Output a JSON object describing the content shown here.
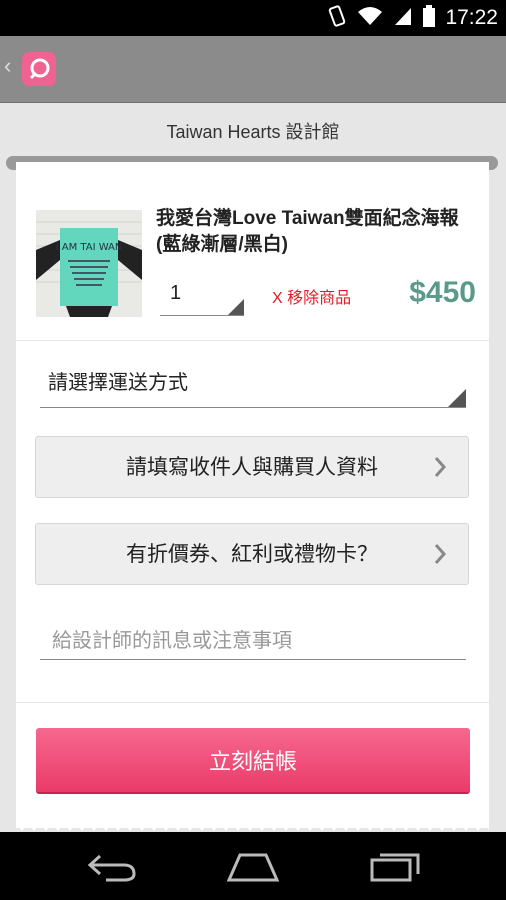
{
  "status_bar": {
    "time": "17:22"
  },
  "app_bar": {
    "back_glyph": "‹"
  },
  "shop": {
    "title": "Taiwan Hearts 設計館"
  },
  "product": {
    "image_text": "I AM TAI WAN",
    "name": "我愛台灣Love Taiwan雙面紀念海報 (藍綠漸層/黑白)",
    "quantity": "1",
    "remove_label": "X 移除商品",
    "price": "$450"
  },
  "shipping": {
    "placeholder": "請選擇運送方式"
  },
  "buttons": {
    "recipient_info": "請填寫收件人與購買人資料",
    "coupon": "有折價券、紅利或禮物卡？"
  },
  "message": {
    "placeholder": "給設計師的訊息或注意事項"
  },
  "checkout": {
    "label": "立刻結帳"
  },
  "colors": {
    "accent": "#ea3b69",
    "price": "#5b9a8b",
    "remove": "#e31b23"
  },
  "icons": [
    "vibrate-icon",
    "wifi-icon",
    "signal-icon",
    "battery-icon",
    "back-chevron-icon",
    "app-logo-icon",
    "chevron-right-icon",
    "nav-back-icon",
    "nav-home-icon",
    "nav-recents-icon"
  ]
}
